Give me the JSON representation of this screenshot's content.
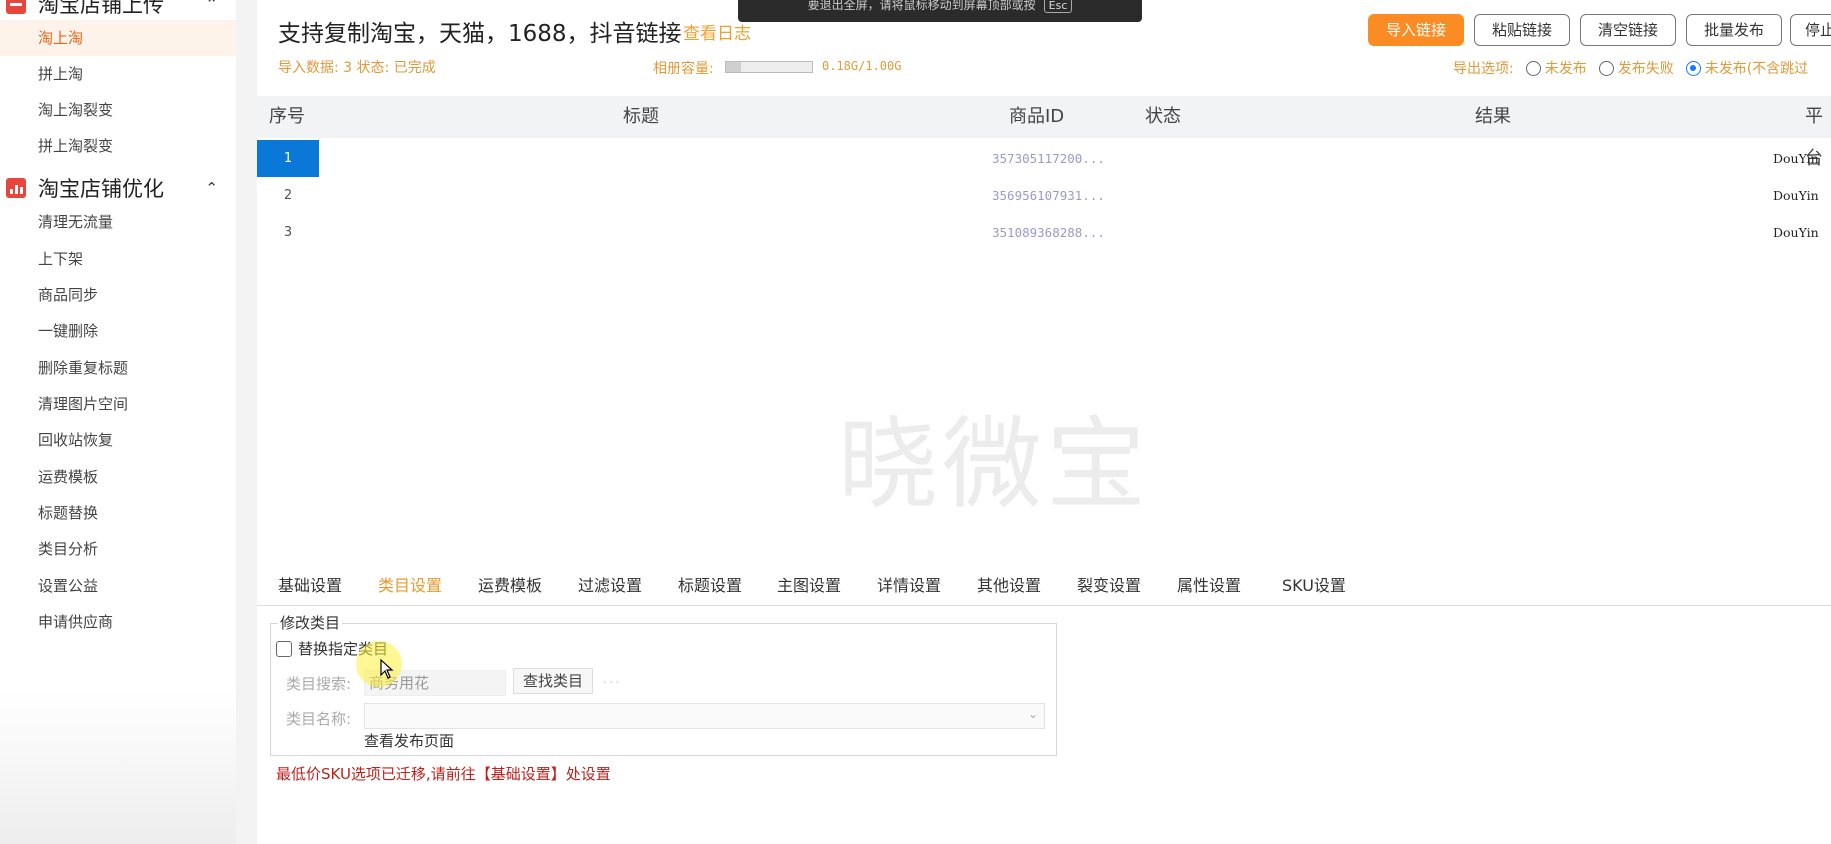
{
  "sidebar": {
    "groups": [
      {
        "label": "淘宝店铺上传",
        "icon": "store-icon",
        "color": "#e8453c"
      },
      {
        "label": "淘宝店铺优化",
        "icon": "bar-chart-icon",
        "color": "#e8453c"
      }
    ],
    "upload_items": [
      "淘上淘",
      "拼上淘",
      "淘上淘裂变",
      "拼上淘裂变"
    ],
    "optimize_items": [
      "清理无流量",
      "上下架",
      "商品同步",
      "一键删除",
      "删除重复标题",
      "清理图片空间",
      "回收站恢复",
      "运费模板",
      "标题替换",
      "类目分析",
      "设置公益",
      "申请供应商"
    ]
  },
  "header": {
    "title": "支持复制淘宝，天猫，1688，抖音链接",
    "view_log": "查看日志",
    "import_info": "导入数据: 3 状态: 已完成",
    "capacity_label": "相册容量:",
    "capacity_value": "0.18G/1.00G",
    "capacity_fraction": 0.18
  },
  "toolbar": {
    "import": "导入链接",
    "paste": "粘贴链接",
    "clear": "清空链接",
    "batch": "批量发布",
    "stop": "停止"
  },
  "export": {
    "label": "导出选项:",
    "options": [
      "未发布",
      "发布失败",
      "未发布(不含跳过"
    ],
    "selected": 2
  },
  "table": {
    "columns": [
      "序号",
      "标题",
      "商品ID",
      "状态",
      "结果",
      "平台"
    ],
    "rows": [
      {
        "idx": "1",
        "pid": "357305117200...",
        "platform": "DouYin"
      },
      {
        "idx": "2",
        "pid": "356956107931...",
        "platform": "DouYin"
      },
      {
        "idx": "3",
        "pid": "351089368288...",
        "platform": "DouYin"
      }
    ]
  },
  "watermark": "晓微宝",
  "tabs": [
    "基础设置",
    "类目设置",
    "运费模板",
    "过滤设置",
    "标题设置",
    "主图设置",
    "详情设置",
    "其他设置",
    "裂变设置",
    "属性设置",
    "SKU设置"
  ],
  "active_tab": 1,
  "category": {
    "legend": "修改类目",
    "checkbox": "替换指定类目",
    "search_label": "类目搜索:",
    "search_value": "商务用花",
    "find_button": "查找类目",
    "dots": "...",
    "name_label": "类目名称:",
    "view_publish": "查看发布页面",
    "warning": "最低价SKU选项已迁移,请前往【基础设置】处设置"
  },
  "toast": {
    "message": "要退出全屏，请将鼠标移动到屏幕顶部或按",
    "key": "Esc"
  }
}
